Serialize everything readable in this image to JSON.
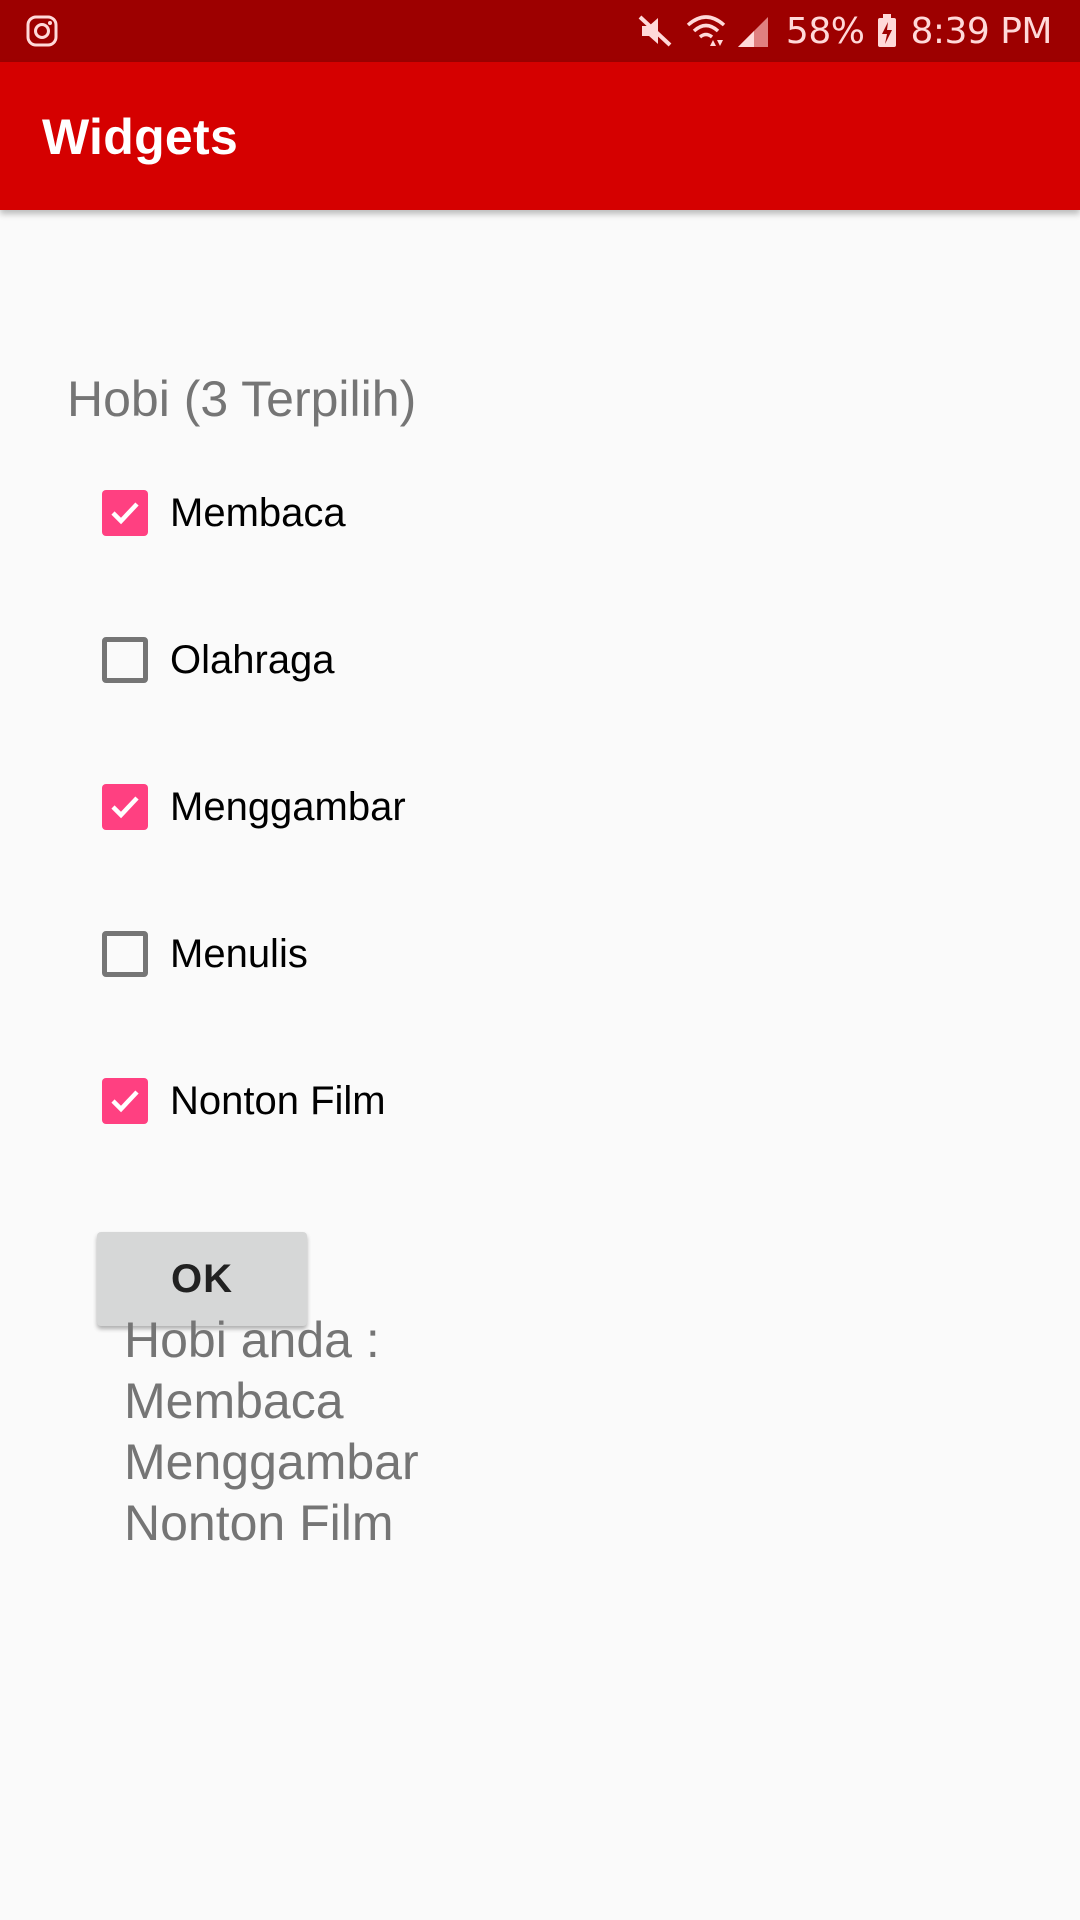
{
  "status_bar": {
    "left_icon": "instagram-icon",
    "icons": [
      "mute-icon",
      "wifi-icon",
      "signal-icon"
    ],
    "battery_percent": "58%",
    "battery_icon": "battery-charging-icon",
    "time": "8:39 PM",
    "background": "#9d0000"
  },
  "app_bar": {
    "title": "Widgets",
    "background": "#d50000"
  },
  "main": {
    "heading": "Hobi (3 Terpilih)",
    "checkboxes": [
      {
        "label": "Membaca",
        "checked": true
      },
      {
        "label": "Olahraga",
        "checked": false
      },
      {
        "label": "Menggambar",
        "checked": true
      },
      {
        "label": "Menulis",
        "checked": false
      },
      {
        "label": "Nonton Film",
        "checked": true
      }
    ],
    "ok_button": "OK",
    "result": {
      "line1": "Hobi anda :",
      "line2": "Membaca",
      "line3": "Menggambar",
      "line4": "Nonton Film"
    },
    "accent_color": "#ff4081"
  }
}
